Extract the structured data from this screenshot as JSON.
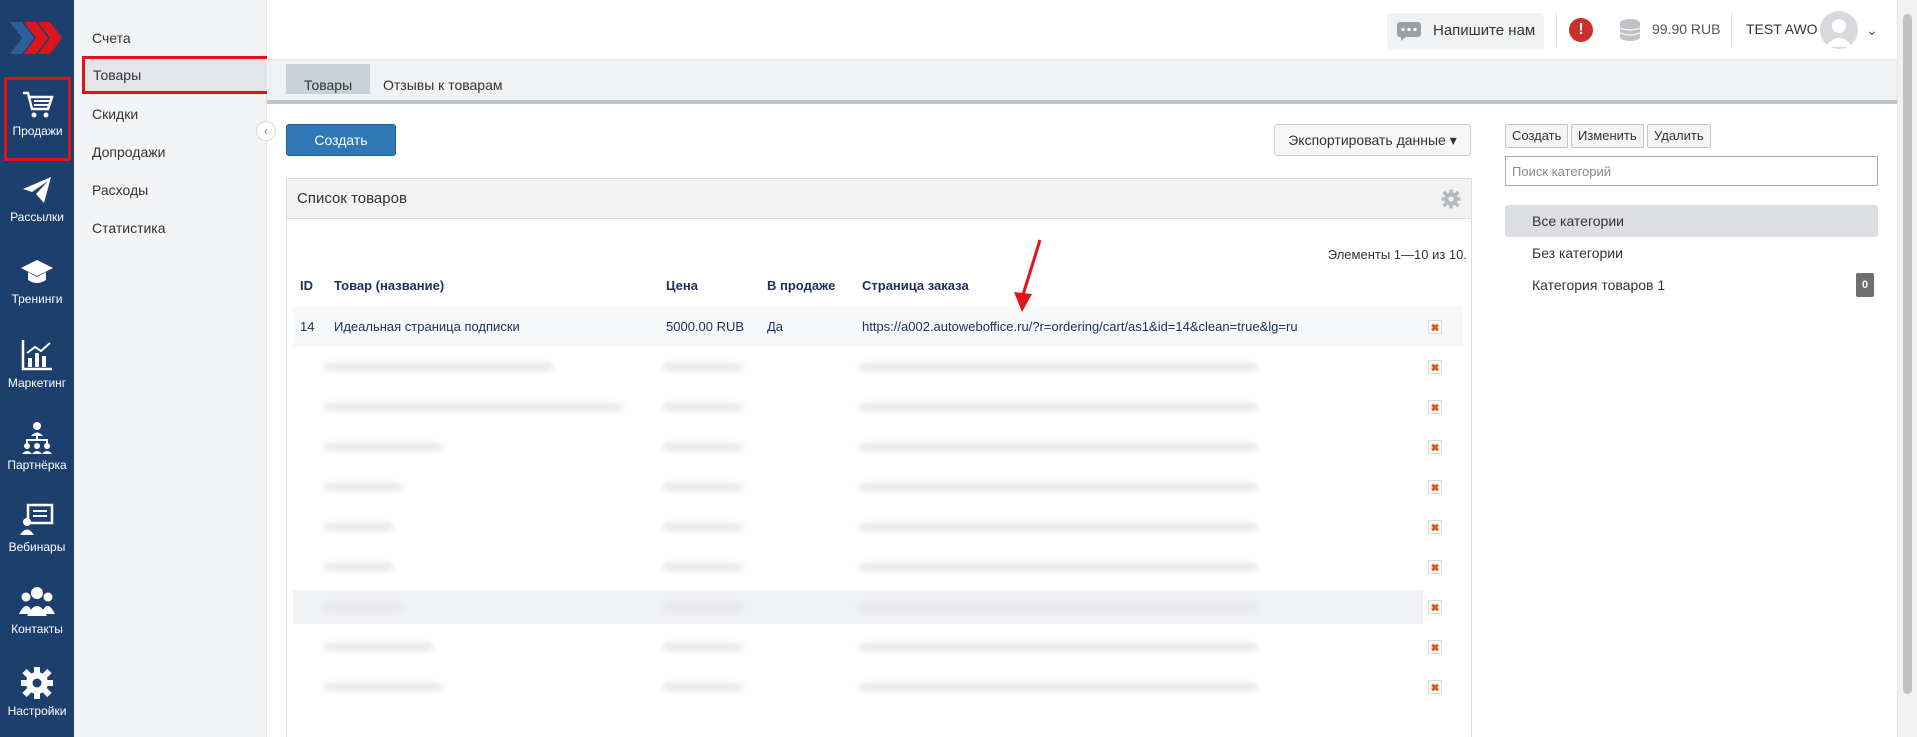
{
  "nav": {
    "items": [
      {
        "label": "Продажи",
        "icon": "cart-icon"
      },
      {
        "label": "Рассылки",
        "icon": "paper-plane-icon"
      },
      {
        "label": "Тренинги",
        "icon": "graduation-cap-icon"
      },
      {
        "label": "Маркетинг",
        "icon": "chart-icon"
      },
      {
        "label": "Партнёрка",
        "icon": "partners-icon"
      },
      {
        "label": "Вебинары",
        "icon": "webinar-icon"
      },
      {
        "label": "Контакты",
        "icon": "contacts-icon"
      },
      {
        "label": "Настройки",
        "icon": "gear-icon"
      }
    ]
  },
  "submenu": {
    "items": [
      "Счета",
      "Товары",
      "Скидки",
      "Допродажи",
      "Расходы",
      "Статистика"
    ]
  },
  "header": {
    "write_us": "Напишите нам",
    "balance": "99.90 RUB",
    "user_name": "TEST AWO"
  },
  "tabs": [
    "Товары",
    "Отзывы к товарам"
  ],
  "toolbar": {
    "create_label": "Создать",
    "export_label": "Экспортировать данные ▾"
  },
  "products": {
    "title": "Список товаров",
    "count_text": "Элементы 1—10 из 10.",
    "columns": [
      "ID",
      "Товар (название)",
      "Цена",
      "В продаже",
      "Страница заказа"
    ],
    "rows": [
      {
        "id": "14",
        "name": "Идеальная страница подписки",
        "price": "5000.00 RUB",
        "on_sale": "Да",
        "order_page": "https://a002.autoweboffice.ru/?r=ordering/cart/as1&id=14&clean=true&lg=ru"
      }
    ]
  },
  "categories": {
    "buttons": [
      "Создать",
      "Изменить",
      "Удалить"
    ],
    "search_placeholder": "Поиск категорий",
    "items": [
      "Все категории",
      "Без категории",
      "Категория товаров 1"
    ],
    "badge": "0"
  }
}
